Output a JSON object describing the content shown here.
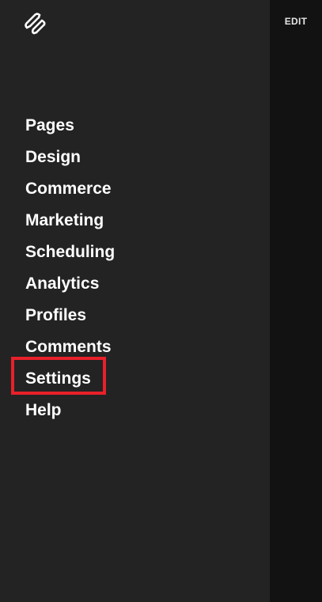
{
  "header": {
    "logo_icon": "squarespace-logo-icon",
    "edit_label": "EDIT"
  },
  "nav": {
    "items": [
      {
        "label": "Pages"
      },
      {
        "label": "Design"
      },
      {
        "label": "Commerce"
      },
      {
        "label": "Marketing"
      },
      {
        "label": "Scheduling"
      },
      {
        "label": "Analytics"
      },
      {
        "label": "Profiles"
      },
      {
        "label": "Comments"
      },
      {
        "label": "Settings"
      },
      {
        "label": "Help"
      }
    ]
  },
  "annotation": {
    "highlight_color": "#e8202a",
    "highlighted_item": "Settings"
  }
}
